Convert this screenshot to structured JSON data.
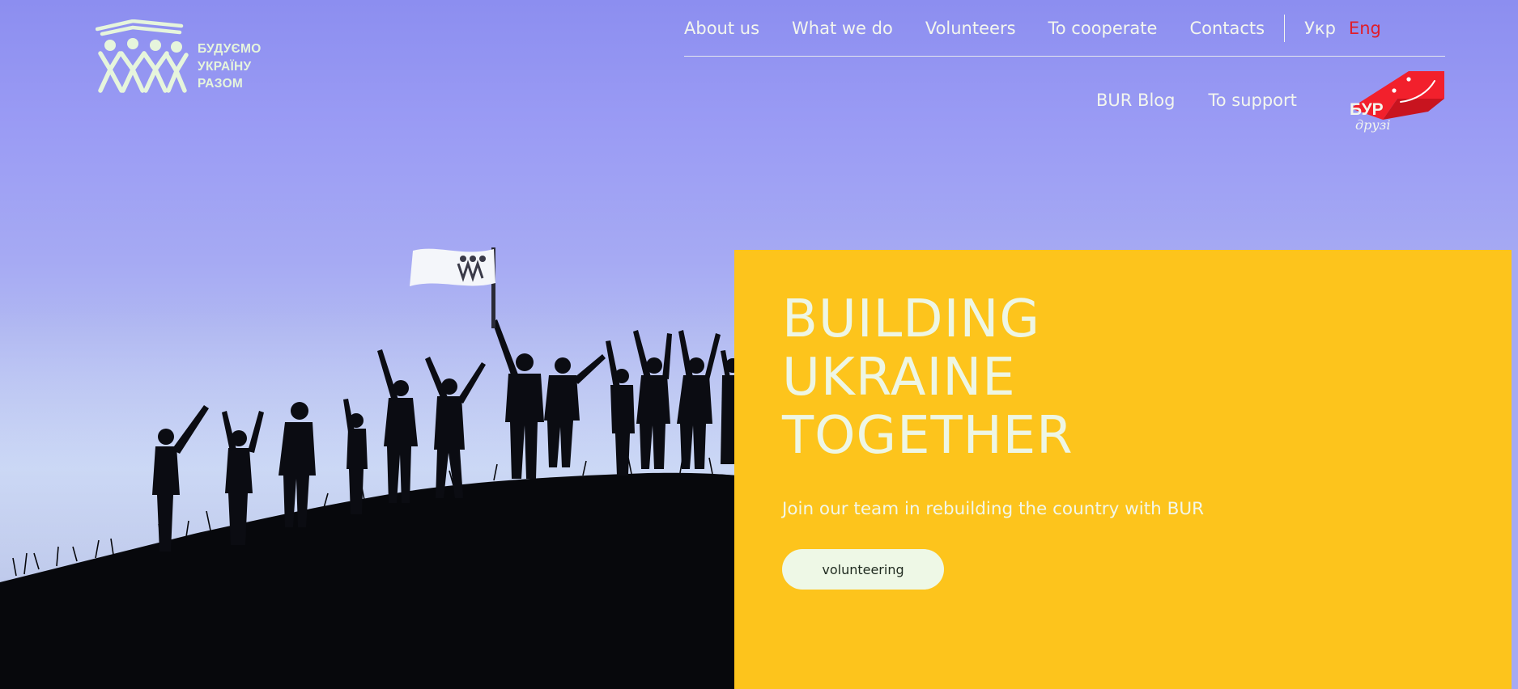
{
  "logo": {
    "lines": [
      "БУДУЄМО",
      "УКРАЇНУ",
      "РАЗОМ"
    ]
  },
  "nav": {
    "primary": [
      {
        "label": "About us"
      },
      {
        "label": "What we do"
      },
      {
        "label": "Volunteers"
      },
      {
        "label": "To cooperate"
      },
      {
        "label": "Contacts"
      }
    ],
    "languages": {
      "ukr": "Укр",
      "eng": "Eng",
      "active": "eng"
    },
    "secondary": [
      {
        "label": "BUR Blog"
      },
      {
        "label": "To support"
      }
    ],
    "badge": {
      "text_top": "БУР",
      "text_script": "друзі"
    }
  },
  "hero": {
    "headline": [
      "BUILDING",
      "UKRAINE",
      "TOGETHER"
    ],
    "subtitle": "Join our team in rebuilding the country with BUR",
    "cta_label": "volunteering"
  },
  "colors": {
    "sky": "#9a9bf4",
    "card": "#fdc41c",
    "logo": "#e6f5dc",
    "active_language": "#e11d2a",
    "badge": "#f2202c",
    "cta_bg": "#eef8e6"
  },
  "icons": {
    "logo": "building-people-icon",
    "badge": "bur-friends-badge-icon"
  }
}
